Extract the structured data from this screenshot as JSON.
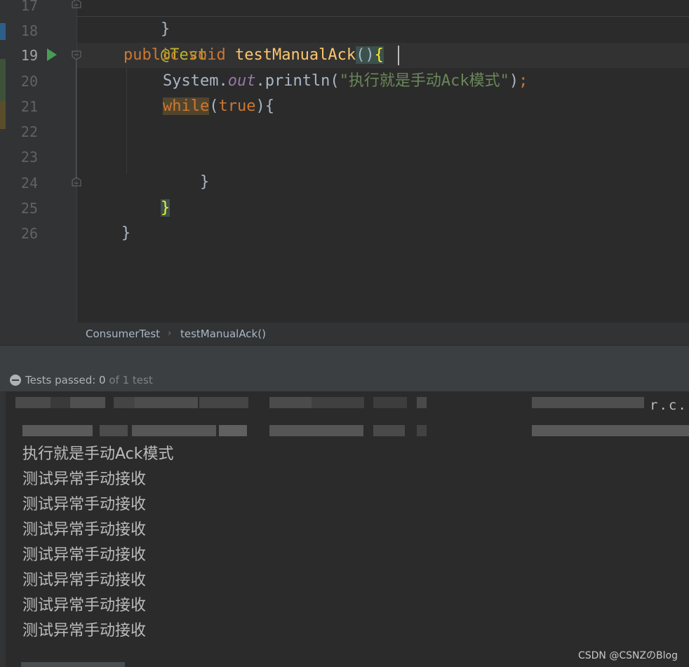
{
  "editor": {
    "line_numbers": [
      "17",
      "18",
      "19",
      "20",
      "21",
      "22",
      "23",
      "24",
      "25",
      "26"
    ],
    "lines": {
      "l17": {
        "brace": "}"
      },
      "l18": {
        "annotation": "@Test"
      },
      "l19": {
        "kw_public": "public",
        "kw_void": "void",
        "method": "testManualAck",
        "parens": "()",
        "open_brace": "{"
      },
      "l20": {
        "receiver": "System.",
        "field": "out",
        "call": ".println(",
        "string": "\"执行就是手动Ack模式\"",
        "close": ")",
        "semi": ";"
      },
      "l21": {
        "kw_while": "while",
        "open_paren": "(",
        "kw_true": "true",
        "rest": "){"
      },
      "l23": {
        "brace": "}"
      },
      "l24": {
        "brace": "}"
      },
      "l25": {
        "brace": "}"
      }
    }
  },
  "breadcrumb": {
    "class_name": "ConsumerTest",
    "separator": "›",
    "method_name": "testManualAck()"
  },
  "test_status": {
    "label": "Tests passed: ",
    "passed": "0",
    "rest": " of 1 test"
  },
  "console": {
    "partial_text": "r.c.",
    "output_lines": [
      "执行就是手动Ack模式",
      "测试异常手动接收",
      "测试异常手动接收",
      "测试异常手动接收",
      "测试异常手动接收",
      "测试异常手动接收",
      "测试异常手动接收",
      "测试异常手动接收"
    ]
  },
  "watermark": "CSDN @CSNZのBlog",
  "colors": {
    "background": "#2b2b2b",
    "keyword": "#cc7832",
    "annotation": "#bbb529",
    "method": "#ffc66d",
    "string": "#6a8759",
    "field": "#9876aa",
    "run_icon": "#499c54"
  }
}
